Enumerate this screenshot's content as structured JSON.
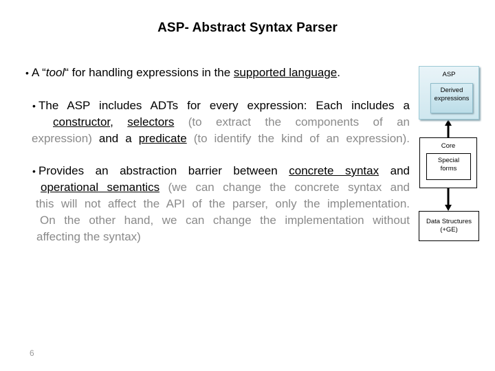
{
  "slide": {
    "title": "ASP- Abstract Syntax Parser",
    "page_number": "6"
  },
  "bullets": [
    {
      "bullet_glyph": "•",
      "parts": {
        "p1": "A “",
        "p2": "tool",
        "p3": "“ for handling expressions in the ",
        "p4": "supported language",
        "p5": "."
      }
    },
    {
      "bullet_glyph": "•",
      "lines": {
        "l1": "The ASP includes ADTs for every expression: Each includes a",
        "l2_u1": "constructor",
        "l2_t1": ", ",
        "l2_u2": "selectors",
        "l2_t2": " (to extract the components of an",
        "l3_t1": "expression)",
        "l3_t2": " and a ",
        "l3_u1": "predicate",
        "l3_t3": " (to identify the kind of an expression)."
      }
    },
    {
      "bullet_glyph": "•",
      "lines": {
        "l1_t1": "Provides an abstraction barrier between ",
        "l1_u1": "concrete syntax",
        "l1_t2": " and",
        "l2_u1": "operational semantics",
        "l2_t1": " (we can change the concrete syntax and",
        "l3": "this will not affect the API of the parser, only the implementation.",
        "l4": "On the other hand, we can change the implementation without",
        "l5": "affecting the syntax)"
      }
    }
  ],
  "diagram": {
    "asp_label": "ASP",
    "derived_label_1": "Derived",
    "derived_label_2": "expressions",
    "core_label": "Core",
    "special_label_1": "Special",
    "special_label_2": "forms",
    "ds_label_1": "Data Structures",
    "ds_label_2": "(+GE)",
    "colors": {
      "asp_fill": "#cfe7ef",
      "asp_border": "#9cc9d5",
      "text_gray": "#8a8a8a"
    }
  }
}
